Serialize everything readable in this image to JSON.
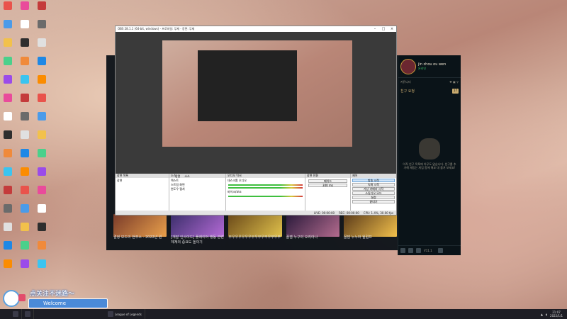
{
  "desktop": {
    "icons_col1": [
      "",
      "",
      "",
      "",
      "",
      "",
      "",
      "",
      "",
      "",
      "",
      "",
      "",
      "",
      ""
    ],
    "icons_col2": [
      "",
      "",
      "",
      "",
      "",
      "",
      "",
      "",
      "",
      "",
      "",
      "",
      "",
      "",
      ""
    ],
    "icons_col3": [
      "",
      "",
      "",
      "",
      "",
      "",
      "",
      "",
      "",
      "",
      "",
      "",
      "",
      "",
      ""
    ]
  },
  "game": {
    "captions": [
      "결정 모드의 현주소 - 2022년 원",
      "[개발 인사이드] 플레이어 행동 관련 체계의 중요도 높이기",
      "부우우우우우우부우부우부우부우부",
      "꿀잼 누구야 오리아나",
      "꿀잼 누누와 윌럼프"
    ]
  },
  "friends": {
    "name": "jin zhou ou wen",
    "status": "온라인",
    "tab": "커뮤니티",
    "requests_label": "친구 요청",
    "requests_badge": "17",
    "empty_text": "아직 친구 목록에 아무도 없습니다. 친구를 추가해 재밌는 게임 함께 해요 대 즐겨 보세요!",
    "voice": "0",
    "version": "V11.1"
  },
  "obs": {
    "title": "OBS 28.1.1 (64-bit, windows) - 프로파일: 무제 - 장면: 무제",
    "scene_tabs": [
      "장면",
      "소스"
    ],
    "scenes_header": "장면 목록",
    "scenes": [
      "장면"
    ],
    "sources_header": "소스",
    "sources": [
      "텍스트",
      "스트림 화면",
      "윈도우 캡처"
    ],
    "mixer_header": "오디오 믹서",
    "mixer_tracks": [
      "데스크톱 오디오",
      "마이크/보조"
    ],
    "transitions_header": "장면 전환",
    "transition": "페이드",
    "duration": "300 ms",
    "controls_header": "제어",
    "controls": [
      "방송 시작",
      "녹화 시작",
      "가상 카메라 시작",
      "스튜디오 모드",
      "설정",
      "끝내기"
    ],
    "status": [
      "LIVE: 00:00:00",
      "REC: 00:00:00",
      "CPU: 1.4%, 30.00 fps"
    ]
  },
  "sticker": {
    "text": "点关注不迷路～",
    "bar": "Welcome"
  },
  "taskbar": {
    "app": "League of Legends",
    "time": "21:07",
    "date": "2022/1/1"
  }
}
